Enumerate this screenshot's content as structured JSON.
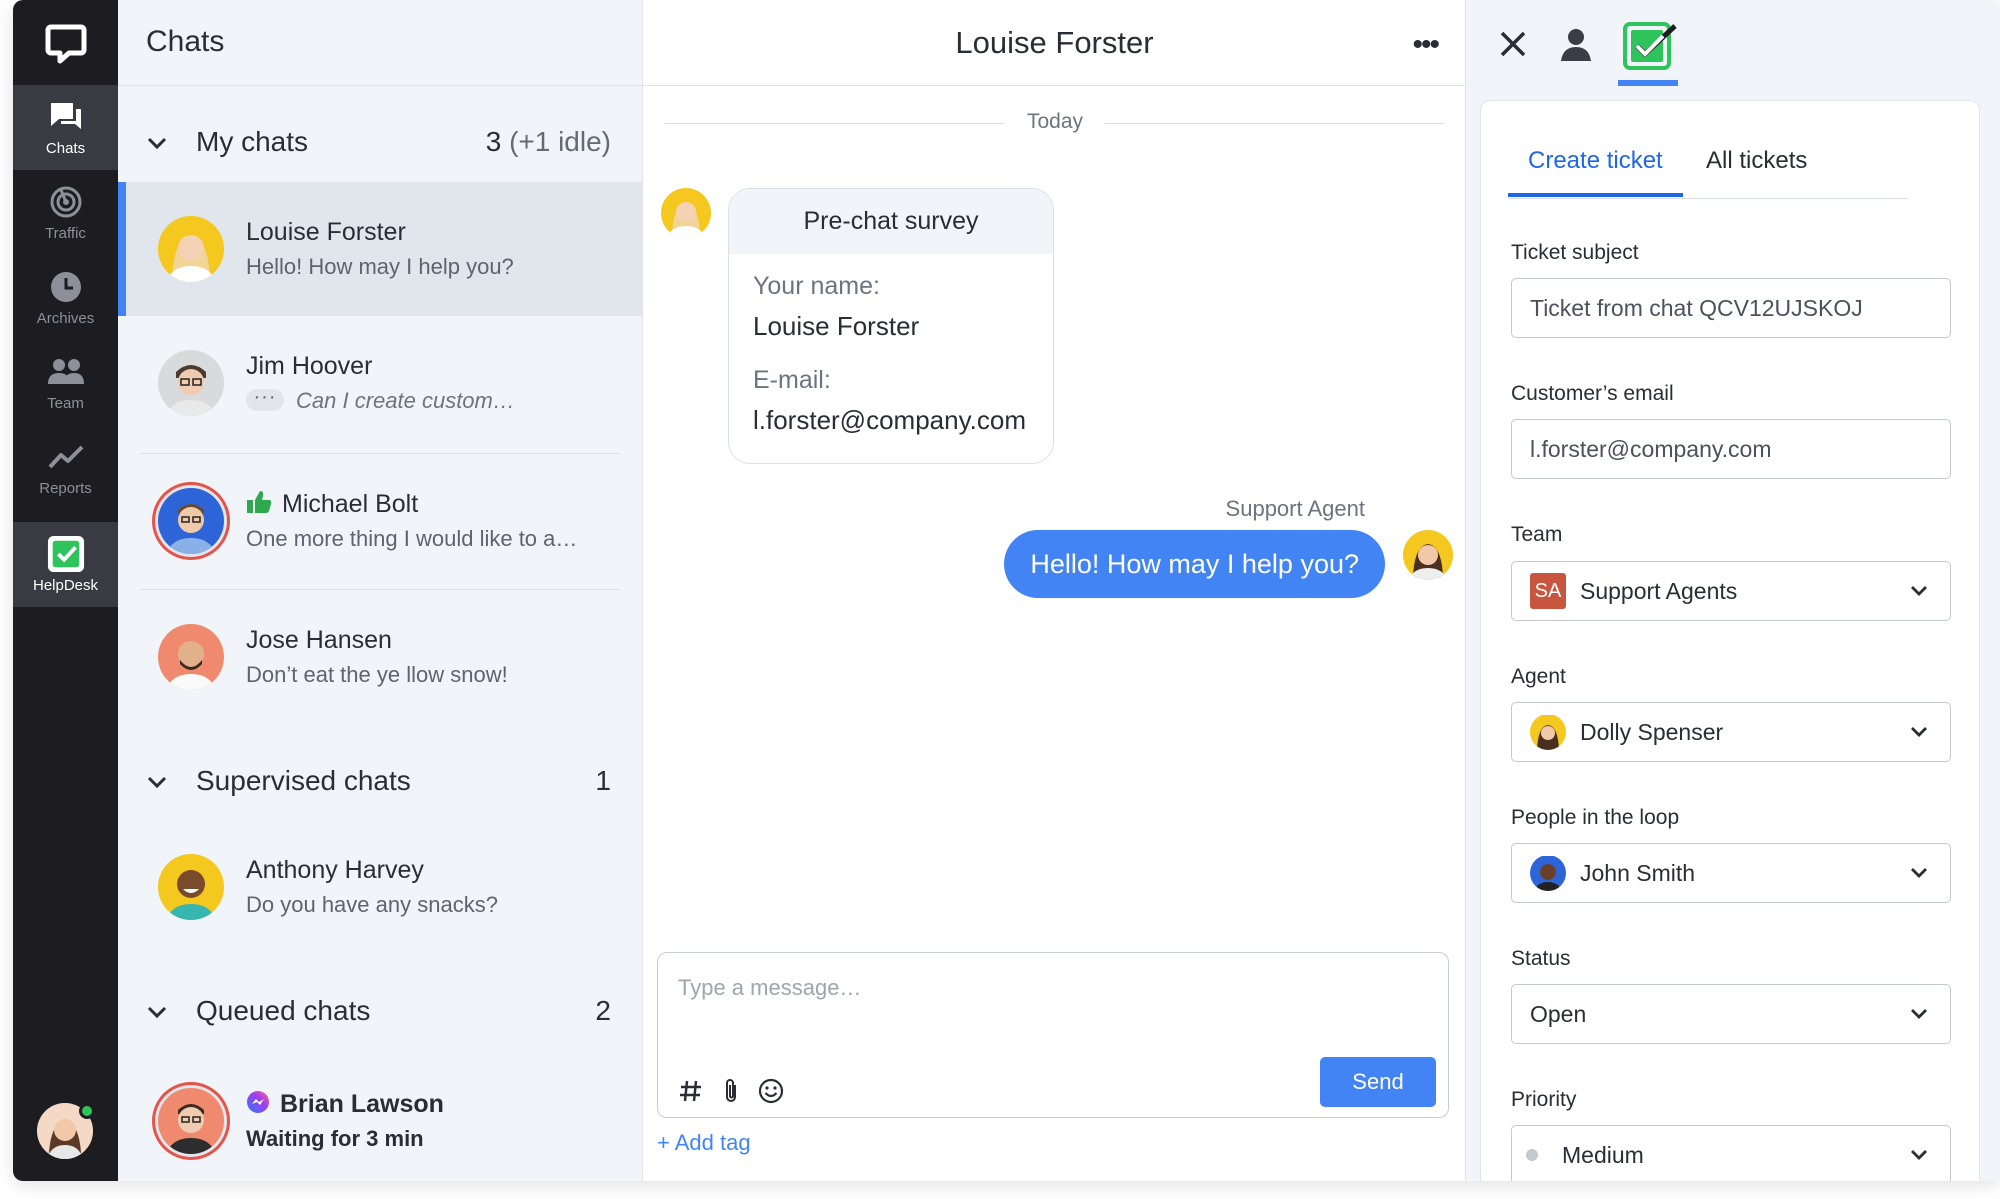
{
  "nav": {
    "items": [
      {
        "label": "Chats",
        "icon": "chats-icon"
      },
      {
        "label": "Traffic",
        "icon": "traffic-icon"
      },
      {
        "label": "Archives",
        "icon": "archives-icon"
      },
      {
        "label": "Team",
        "icon": "team-icon"
      },
      {
        "label": "Reports",
        "icon": "reports-icon"
      },
      {
        "label": "HelpDesk",
        "icon": "helpdesk-icon"
      }
    ],
    "status_color": "#2fc35c"
  },
  "chatlist": {
    "title": "Chats",
    "my_chats": {
      "title": "My chats",
      "count": "3",
      "idle": "(+1 idle)"
    },
    "supervised": {
      "title": "Supervised chats",
      "count": "1"
    },
    "queued": {
      "title": "Queued chats",
      "count": "2"
    },
    "rows": [
      {
        "name": "Louise Forster",
        "message": "Hello! How may I help you?"
      },
      {
        "name": "Jim Hoover",
        "message": "Can I create custom…"
      },
      {
        "name": "Michael Bolt",
        "message": "One more thing I would like to a…"
      },
      {
        "name": "Jose Hansen",
        "message": "Don’t eat the ye llow snow!"
      },
      {
        "name": "Anthony Harvey",
        "message": "Do you have any snacks?"
      },
      {
        "name": "Brian Lawson",
        "message": "Waiting for 3 min"
      }
    ]
  },
  "chat": {
    "title": "Louise Forster",
    "more": "•••",
    "day": "Today",
    "survey": {
      "title": "Pre-chat survey",
      "name_label": "Your name:",
      "name_value": "Louise Forster",
      "email_label": "E-mail:",
      "email_value": "l.forster@company.com"
    },
    "agent_label": "Support Agent",
    "agent_message": "Hello! How may I help you?",
    "composer_placeholder": "Type a message…",
    "send_label": "Send",
    "add_tag": "+ Add tag",
    "accent": "#4384f5"
  },
  "ticket": {
    "tabs": [
      {
        "label": "Create ticket"
      },
      {
        "label": "All tickets"
      }
    ],
    "subject_label": "Ticket subject",
    "subject_value": "Ticket from chat QCV12UJSKOJ",
    "email_label": "Customer’s email",
    "email_value": "l.forster@company.com",
    "team_label": "Team",
    "team_badge": "SA",
    "team_value": "Support Agents",
    "agent_label": "Agent",
    "agent_value": "Dolly Spenser",
    "loop_label": "People in the loop",
    "loop_value": "John Smith",
    "status_label": "Status",
    "status_value": "Open",
    "priority_label": "Priority",
    "priority_value": "Medium",
    "helpdesk_color": "#2fc35c"
  }
}
